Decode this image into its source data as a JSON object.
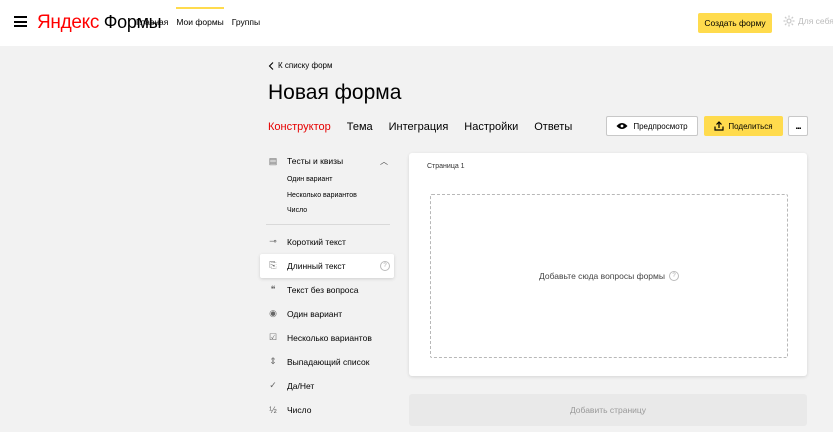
{
  "header": {
    "logo_yandex": "Яндекс",
    "logo_product": "Формы",
    "nav": [
      "Главная",
      "Мои формы",
      "Группы"
    ],
    "create_label": "Создать форму",
    "for_you_label": "Для себя"
  },
  "form": {
    "back_label": "К списку форм",
    "title": "Новая форма"
  },
  "tabs": [
    "Конструктор",
    "Тема",
    "Интеграция",
    "Настройки",
    "Ответы"
  ],
  "actions": {
    "preview_label": "Предпросмотр",
    "share_label": "Поделиться",
    "more_label": "..."
  },
  "palette": {
    "group": {
      "label": "Тесты и квизы",
      "items": [
        "Один вариант",
        "Несколько вариантов",
        "Число"
      ]
    },
    "items": [
      {
        "label": "Короткий текст",
        "icon": "short-text-icon"
      },
      {
        "label": "Длинный текст",
        "icon": "long-text-icon"
      },
      {
        "label": "Текст без вопроса",
        "icon": "quote-icon"
      },
      {
        "label": "Один вариант",
        "icon": "radio-icon"
      },
      {
        "label": "Несколько вариантов",
        "icon": "checkbox-icon"
      },
      {
        "label": "Выпадающий список",
        "icon": "dropdown-icon"
      },
      {
        "label": "Да/Нет",
        "icon": "check-icon"
      },
      {
        "label": "Число",
        "icon": "number-icon"
      }
    ]
  },
  "canvas": {
    "page_label": "Страница 1",
    "dropzone_text": "Добавьте сюда вопросы формы",
    "add_page_label": "Добавить страницу"
  },
  "colors": {
    "accent_yellow": "#ffdb4d",
    "active_tab": "#e60000",
    "logo_red": "#ff0000"
  }
}
